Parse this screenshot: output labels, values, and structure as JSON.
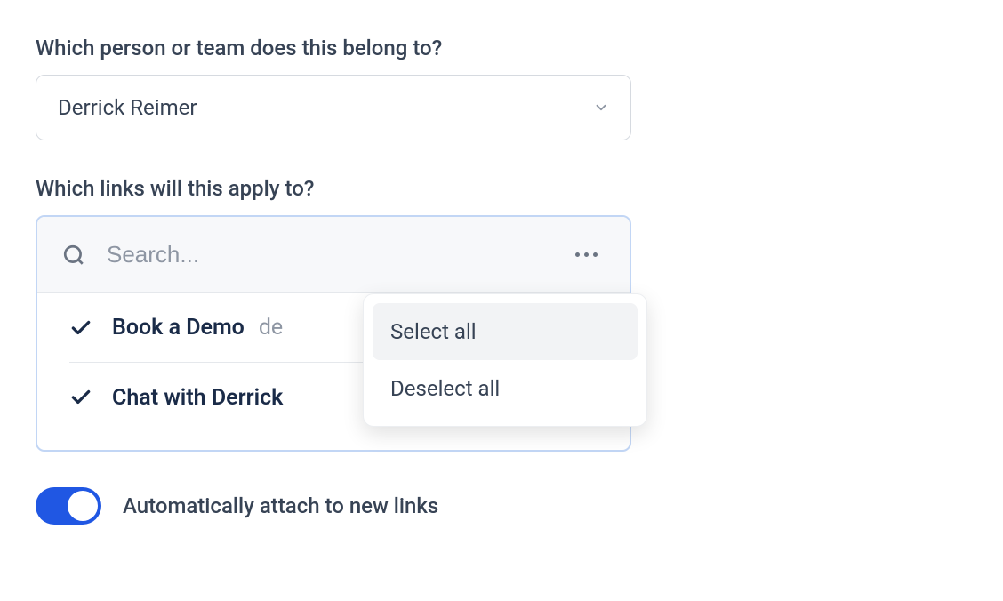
{
  "person_section": {
    "label": "Which person or team does this belong to?",
    "selected": "Derrick Reimer"
  },
  "links_section": {
    "label": "Which links will this apply to?",
    "search_placeholder": "Search...",
    "items": [
      {
        "title": "Book a Demo",
        "subtitle": "de",
        "checked": true
      },
      {
        "title": "Chat with Derrick",
        "subtitle": "",
        "checked": true
      }
    ]
  },
  "popover": {
    "select_all": "Select all",
    "deselect_all": "Deselect all"
  },
  "toggle": {
    "label": "Automatically attach to new links",
    "on": true
  }
}
